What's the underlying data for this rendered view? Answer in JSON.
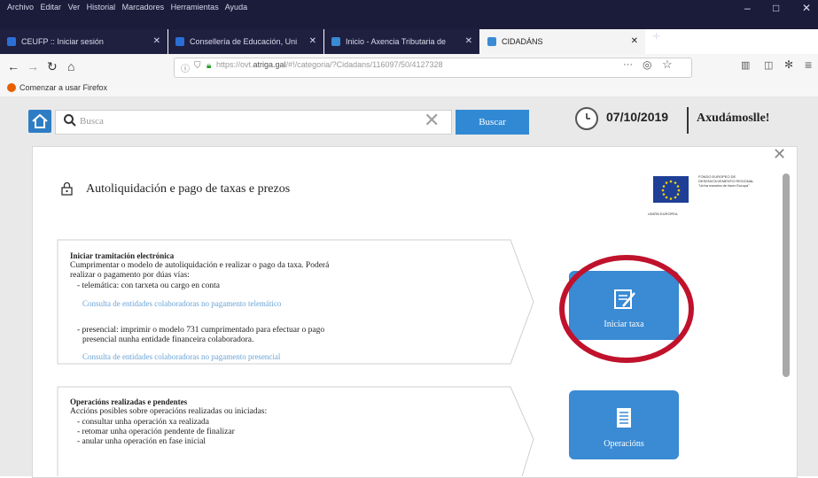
{
  "browser": {
    "menu": [
      "Archivo",
      "Editar",
      "Ver",
      "Historial",
      "Marcadores",
      "Herramientas",
      "Ayuda"
    ],
    "window_controls": {
      "minimize": "–",
      "maximize": "□",
      "close": "✕"
    },
    "tabs": [
      {
        "label": "CEUFP :: Iniciar sesión",
        "close": "✕",
        "icon_color": "#2b6fd6"
      },
      {
        "label": "Consellería de Educación, Uni",
        "close": "✕",
        "icon_color": "#2b6fd6"
      },
      {
        "label": "Inicio - Axencia Tributaria de",
        "close": "✕",
        "icon_color": "#3a8ad4"
      },
      {
        "label": "CIDADÁNS",
        "close": "✕",
        "icon_color": "#3a8ad4"
      }
    ],
    "new_tab": "+",
    "url": {
      "prefix": "https://ovt.",
      "domain": "atriga.gal",
      "path": "/#!/categoria/?Cidadans/116097/50/4127328"
    },
    "url_more": "···",
    "bookmark": "Comenzar a usar Firefox"
  },
  "topbar": {
    "search_placeholder": "Busca",
    "clear": "✕",
    "search_button": "Buscar",
    "date": "07/10/2019",
    "help": "Axudámoslle!"
  },
  "panel": {
    "close": "✕",
    "title": "Autoliquidación e pago de taxas e prezos",
    "eu_text": "FONDO EUROPEO DE DESENVOLVEMENTO REXIONAL \"Unha maneira de facer Europa\"",
    "eu_under": "UNIÓN EUROPEA",
    "section1": {
      "title": "Iniciar tramitación electrónica",
      "line1": "Cumprimentar o modelo de autoliquidación e realizar o pago da taxa. Poderá",
      "line2": "realizar o pagamento por dúas vías:",
      "bullet1": "- telemática: con tarxeta ou cargo en conta",
      "link1": "Consulta de entidades colaboradoras no pagamento telemático",
      "bullet2a": "- presencial: imprimir o modelo 731 cumprimentado para efectuar o pago",
      "bullet2b": "presencial nunha entidade financeira colaboradora.",
      "link2": "Consulta de entidades colaboradoras no pagamento presencial",
      "button": "Iniciar taxa"
    },
    "section2": {
      "title": "Operacións realizadas e pendentes",
      "line1": "Accións posibles sobre operacións realizadas ou iniciadas:",
      "bullet1": "- consultar unha operación xa realizada",
      "bullet2": "- retomar unha operación pendente de finalizar",
      "bullet3": "- anular unha operación en fase inicial",
      "button": "Operacións"
    }
  },
  "colors": {
    "accent": "#3189d4",
    "highlight_circle": "#c0122c",
    "titlebar": "#1b1b3a"
  }
}
